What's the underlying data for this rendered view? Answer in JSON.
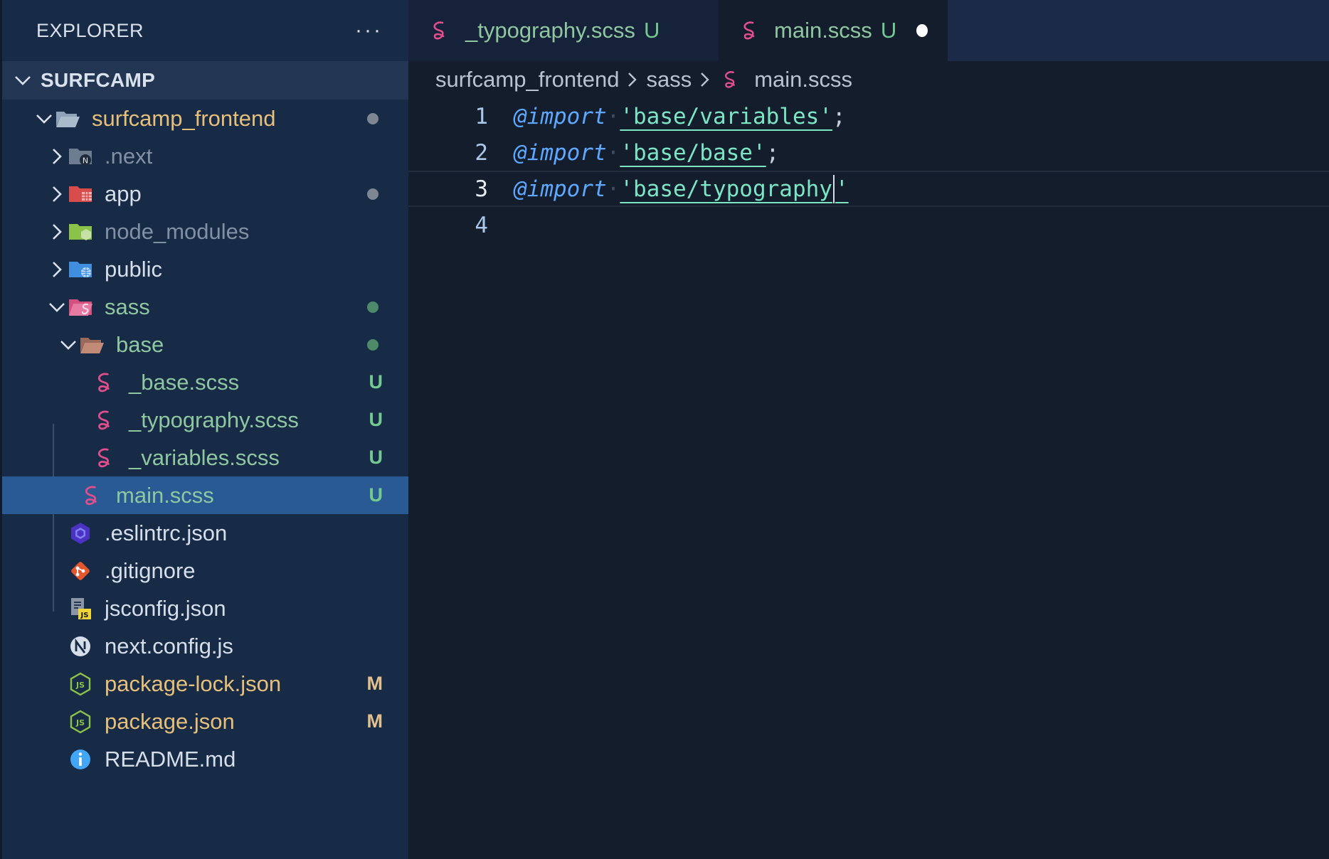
{
  "sidebar": {
    "title": "EXPLORER",
    "more": "···",
    "section": "SURFCAMP",
    "tree": [
      {
        "name": "surfcamp_frontend",
        "color": "yellow",
        "icon": "folder-open-icon",
        "level": 0,
        "chevron": "down",
        "dot": "#7d8794"
      },
      {
        "name": ".next",
        "color": "grey",
        "icon": "folder-next-icon",
        "level": 1,
        "chevron": "right"
      },
      {
        "name": "app",
        "color": "white",
        "icon": "folder-app-icon",
        "level": 1,
        "chevron": "right",
        "dot": "#7d8794"
      },
      {
        "name": "node_modules",
        "color": "grey",
        "icon": "folder-node-icon",
        "level": 1,
        "chevron": "right"
      },
      {
        "name": "public",
        "color": "white",
        "icon": "folder-public-icon",
        "level": 1,
        "chevron": "right"
      },
      {
        "name": "sass",
        "color": "green",
        "icon": "folder-sass-icon",
        "level": 1,
        "chevron": "down",
        "dot": "#4e8a6a"
      },
      {
        "name": "base",
        "color": "green",
        "icon": "folder-base-icon",
        "level": 2,
        "chevron": "down",
        "dot": "#4e8a6a"
      },
      {
        "name": "_base.scss",
        "color": "green",
        "icon": "sass-icon",
        "level": 3,
        "badge": "U"
      },
      {
        "name": "_typography.scss",
        "color": "green",
        "icon": "sass-icon",
        "level": 3,
        "badge": "U"
      },
      {
        "name": "_variables.scss",
        "color": "green",
        "icon": "sass-icon",
        "level": 3,
        "badge": "U"
      },
      {
        "name": "main.scss",
        "color": "green",
        "icon": "sass-icon",
        "level": 2,
        "badge": "U",
        "selected": true
      },
      {
        "name": ".eslintrc.json",
        "color": "white",
        "icon": "eslint-icon",
        "level": 1
      },
      {
        "name": ".gitignore",
        "color": "white",
        "icon": "git-icon",
        "level": 1
      },
      {
        "name": "jsconfig.json",
        "color": "white",
        "icon": "jsconfig-icon",
        "level": 1
      },
      {
        "name": "next.config.js",
        "color": "white",
        "icon": "nextjs-icon",
        "level": 1
      },
      {
        "name": "package-lock.json",
        "color": "yellow",
        "icon": "nodejs-icon",
        "level": 1,
        "badge": "M"
      },
      {
        "name": "package.json",
        "color": "yellow",
        "icon": "nodejs-icon",
        "level": 1,
        "badge": "M"
      },
      {
        "name": "README.md",
        "color": "white",
        "icon": "info-icon",
        "level": 1
      }
    ]
  },
  "tabs": [
    {
      "label": "_typography.scss",
      "mark": "U",
      "active": false
    },
    {
      "label": "main.scss",
      "mark": "U",
      "active": true,
      "modified": true
    }
  ],
  "breadcrumb": [
    "surfcamp_frontend",
    "sass",
    "main.scss"
  ],
  "code": [
    {
      "num": "1",
      "kw": "@import",
      "str": "'base/variables'",
      "end": ";"
    },
    {
      "num": "2",
      "kw": "@import",
      "str": "'base/base'",
      "end": ";"
    },
    {
      "num": "3",
      "kw": "@import",
      "str_before_cursor": "'base/typography",
      "str_after_cursor": "'",
      "current": true
    },
    {
      "num": "4"
    }
  ],
  "colors": {
    "sidebar_bg": "#172a46",
    "editor_bg": "#141d2c",
    "selected": "#2a5a93",
    "sass_pink": "#e04f8b",
    "keyword": "#5ea8ff",
    "string": "#7ce6c4"
  }
}
